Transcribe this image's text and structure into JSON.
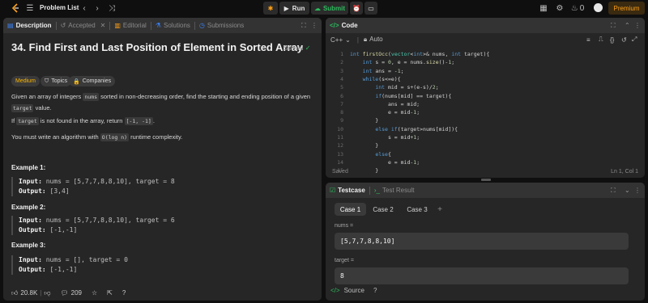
{
  "topbar": {
    "problem_list": "Problem List",
    "run": "Run",
    "submit": "Submit",
    "streak": "0",
    "premium": "Premium"
  },
  "left_tabs": [
    {
      "label": "Description",
      "icon": "document-icon",
      "active": true
    },
    {
      "label": "Accepted",
      "icon": "history-icon",
      "active": false
    },
    {
      "label": "Editorial",
      "icon": "book-icon",
      "active": false
    },
    {
      "label": "Solutions",
      "icon": "flask-icon",
      "active": false
    },
    {
      "label": "Submissions",
      "icon": "clock-icon",
      "active": false
    }
  ],
  "problem": {
    "title": "34. Find First and Last Position of Element in Sorted Array",
    "status": "Solved",
    "difficulty": "Medium",
    "topics": "Topics",
    "companies": "Companies",
    "p1_a": "Given an array of integers ",
    "p1_code": "nums",
    "p1_b": " sorted in non-decreasing order, find the starting and ending position of a given",
    "p1_code2": "target",
    "p1_c": " value.",
    "p2_a": "If ",
    "p2_code": "target",
    "p2_b": " is not found in the array, return ",
    "p2_code2": "[-1, -1]",
    "p2_c": ".",
    "p3_a": "You must write an algorithm with ",
    "p3_code": "O(log n)",
    "p3_b": " runtime complexity.",
    "examples": [
      {
        "title": "Example 1:",
        "input": "nums = [5,7,7,8,8,10], target = 8",
        "output": "[3,4]"
      },
      {
        "title": "Example 2:",
        "input": "nums = [5,7,7,8,8,10], target = 6",
        "output": "[-1,-1]"
      },
      {
        "title": "Example 3:",
        "input": "nums = [], target = 0",
        "output": "[-1,-1]"
      }
    ],
    "input_label": "Input:",
    "output_label": "Output:",
    "likes": "20.8K",
    "comments": "209"
  },
  "code": {
    "tab": "Code",
    "language": "C++",
    "mode": "Auto",
    "saved": "Saved",
    "cursor": "Ln 1, Col 1",
    "lines": [
      "int firstOcc(vector<int>& nums, int target){",
      "    int s = 0, e = nums.size()-1;",
      "    int ans = -1;",
      "    while(s<=e){",
      "        int mid = s+(e-s)/2;",
      "        if(nums[mid] == target){",
      "            ans = mid;",
      "            e = mid-1;",
      "        }",
      "        else if(target>nums[mid]){",
      "            s = mid+1;",
      "        }",
      "        else{",
      "            e = mid-1;",
      "        }"
    ]
  },
  "testcase": {
    "tab": "Testcase",
    "result_tab": "Test Result",
    "cases": [
      "Case 1",
      "Case 2",
      "Case 3"
    ],
    "add": "+",
    "fields": [
      {
        "label": "nums =",
        "value": "[5,7,7,8,8,10]"
      },
      {
        "label": "target =",
        "value": "8"
      }
    ],
    "source": "Source"
  },
  "colors": {
    "accent": "#ffa116",
    "green": "#2cbb5d",
    "medium": "#ffb800",
    "panel": "#262626"
  }
}
